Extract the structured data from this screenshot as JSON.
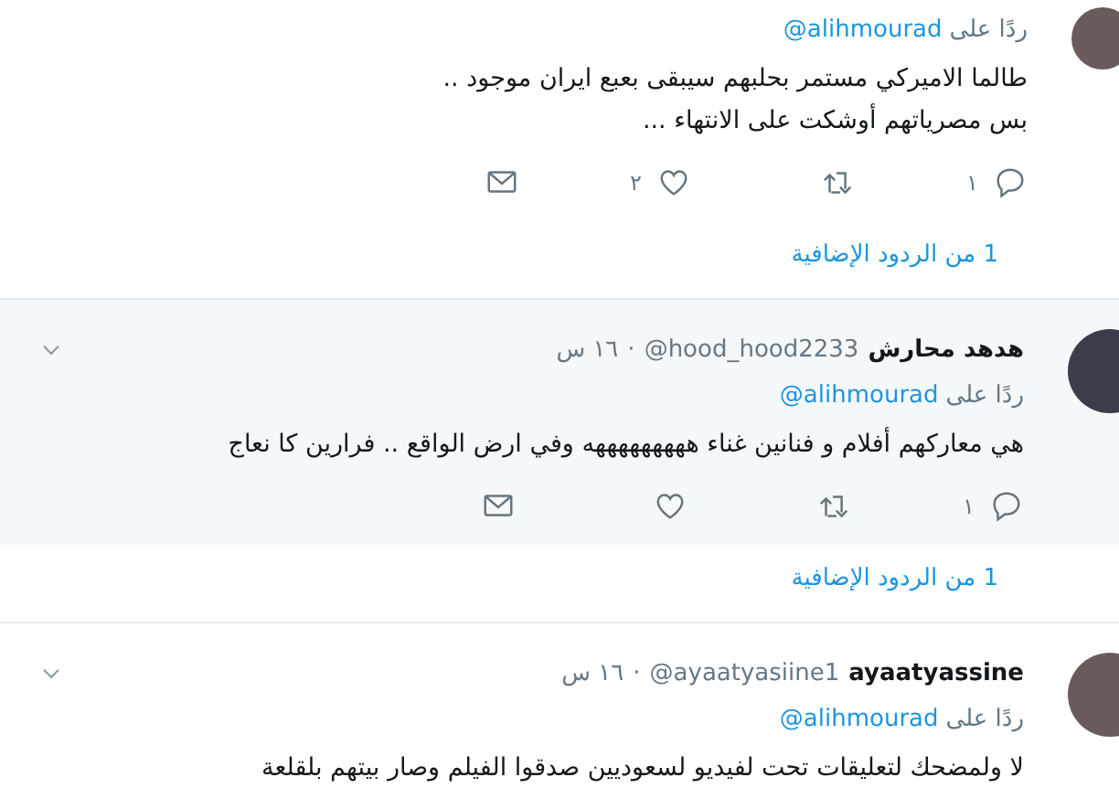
{
  "tweets": [
    {
      "highlighted": false,
      "reply_to_label": "ردًا على",
      "reply_to": "@alihmourad",
      "text": [
        "طالما الاميركي مستمر بحلبهم سيبقى بعبع ايران موجود ..",
        "بس مصرياتهم أوشكت على الانتهاء ..."
      ],
      "reply_count": "١",
      "like_count": "٢",
      "more_replies": "1 من الردود الإضافية"
    },
    {
      "highlighted": true,
      "name": "هدهد محارش",
      "handle": "@hood_hood2233",
      "separator": "·",
      "time": "١٦ س",
      "reply_to_label": "ردًا على",
      "reply_to": "@alihmourad",
      "text": [
        "هي معاركهم أفلام و فنانين غناء هههههههههه وفي ارض الواقع .. فرارين كا نعاج"
      ],
      "reply_count": "١",
      "more_replies": "1 من الردود الإضافية"
    },
    {
      "highlighted": false,
      "name": "ayaatyassine",
      "handle": "@ayaatyasiine1",
      "separator": "·",
      "time": "١٦ س",
      "reply_to_label": "ردًا على",
      "reply_to": "@alihmourad",
      "text": [
        "لا ولمضحك لتعليقات تحت لفيديو لسعوديين صدقوا الفيلم وصار بيتهم بلقلعة"
      ]
    }
  ]
}
